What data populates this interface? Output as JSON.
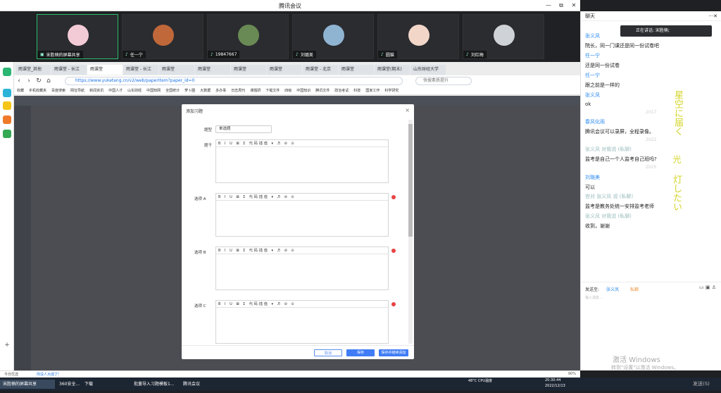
{
  "window": {
    "title": "腾讯会议",
    "min": "—",
    "max": "⧉",
    "close": "✕"
  },
  "videos": [
    {
      "name": "宋胜楠的屏幕共享",
      "icon": "screen-share-icon",
      "active": true,
      "color": "#f3cbd6"
    },
    {
      "name": "任一宁",
      "icon": "mic-icon",
      "active": false,
      "color": "#c0683a"
    },
    {
      "name": "19847667",
      "icon": "mic-icon",
      "active": false,
      "color": "#6a8a55"
    },
    {
      "name": "刘璐美",
      "icon": "mic-icon",
      "active": false,
      "color": "#8fb4d2"
    },
    {
      "name": "圆猫",
      "icon": "mic-icon",
      "active": false,
      "color": "#f2d7c9"
    },
    {
      "name": "刘红梅",
      "icon": "mic-icon",
      "active": false,
      "color": "#cfd2d6"
    }
  ],
  "browser": {
    "tabs": [
      "雨课堂_其他",
      "雨课堂 - 长江",
      "雨课堂",
      "雨课堂 - 长江",
      "雨课堂",
      "雨课堂",
      "雨课堂",
      "雨课堂",
      "雨课堂 - 北京",
      "雨课堂",
      "雨课堂(期末)",
      "山东财经大学"
    ],
    "url": "https://www.yuketang.cn/v2/web/paperItem?paper_id=0",
    "search_placeholder": "快搜素质提升",
    "bookmarks": [
      "收藏",
      "手机收藏夹",
      "百度搜索",
      "网址导航",
      "新闻资讯",
      "中国人才",
      "山东财经",
      "中国知网",
      "全国统计",
      "萝卜圈",
      "大数据",
      "多办事",
      "日志周刊",
      "课题研",
      "下载文件",
      "四级",
      "中国知识",
      "腾讯文件",
      "政治考试",
      "科技",
      "国家工作",
      "科学研究"
    ]
  },
  "modal": {
    "title": "添加习题",
    "close": "×",
    "type_label": "题型",
    "type_value": "单选题",
    "stem_label": "题干",
    "toolbar": "B  I  U  ⊠  Σ  代码插值 ▾  ♬  ⊘  ⊙",
    "options": [
      {
        "label": "选项 A"
      },
      {
        "label": "选项 B"
      },
      {
        "label": "选项 C"
      }
    ],
    "buttons": {
      "cancel": "取消",
      "save": "保存",
      "save_next": "保存并继续添加"
    }
  },
  "status_bar": {
    "left": "今日优选",
    "notice": "你没人大成了!",
    "right": "90%"
  },
  "chat": {
    "header": "聊天",
    "speaking": "正在讲话: 宋胜楠;",
    "messages": [
      {
        "name": "张义凤",
        "text": "院长，同一门课还是同一份试卷吧"
      },
      {
        "name": "任一宁",
        "text": "还是同一份试卷"
      },
      {
        "name": "任一宁",
        "text": "跟之前是一样的"
      },
      {
        "name": "张义凤",
        "text": "ok",
        "time": "2017"
      },
      {
        "name": "春风化雨",
        "text": "腾讯会议可以录屏，全程录像。",
        "time": "2022"
      },
      {
        "name": "张义凤 对我说 (私聊)",
        "text": "监考是自己一个人监考自己班吗?",
        "time": "2025"
      },
      {
        "name": "刘璐美",
        "text": "可以"
      },
      {
        "name": "宫对 张义凤 说 (私聊)",
        "text": "监考是教务处统一安排监考老师"
      },
      {
        "name": "张义凤 对我说 (私聊)",
        "text": "收到，谢谢"
      }
    ],
    "send_to_label": "发送至:",
    "send_to_name": "张义凤",
    "private_label": "私聊",
    "input_placeholder": "输入消息..."
  },
  "watermark": {
    "line1": "激活 Windows",
    "line2": "转到\"设置\"以激活 Windows。"
  },
  "taskbar": {
    "items": [
      "宋胜楠的屏幕共享",
      "360安全...",
      "下载",
      "批量导入习题模板1...",
      "腾讯会议"
    ],
    "weather": "48°C CPU温度",
    "time": "20:30:44",
    "date": "2022/12/13",
    "end": "发送(S)"
  }
}
